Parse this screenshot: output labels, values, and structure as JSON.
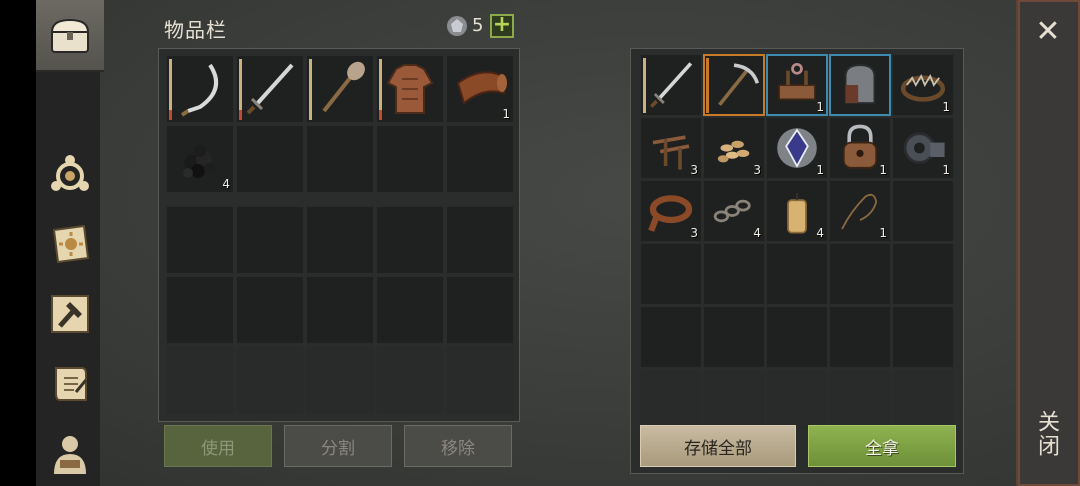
{
  "inventory": {
    "title": "物品栏",
    "gem_count": "5",
    "plus_label": "+",
    "slots_row1": [
      {
        "icon": "sickle-icon",
        "qty": ""
      },
      {
        "icon": "sword-icon",
        "qty": ""
      },
      {
        "icon": "shovel-icon",
        "qty": ""
      },
      {
        "icon": "leather-armor-icon",
        "qty": ""
      },
      {
        "icon": "leather-roll-icon",
        "qty": "1"
      }
    ],
    "slots_row2": [
      {
        "icon": "coal-icon",
        "qty": "4"
      }
    ],
    "buttons": {
      "use": "使用",
      "split": "分割",
      "remove": "移除"
    }
  },
  "container": {
    "items": [
      {
        "icon": "sword-icon",
        "qty": ""
      },
      {
        "icon": "pickaxe-icon",
        "qty": ""
      },
      {
        "icon": "anchor-rack-icon",
        "qty": "1"
      },
      {
        "icon": "armor-gauntlet-icon",
        "qty": ""
      },
      {
        "icon": "bear-trap-icon",
        "qty": "1"
      },
      {
        "icon": "nails-icon",
        "qty": "3"
      },
      {
        "icon": "seeds-icon",
        "qty": "3"
      },
      {
        "icon": "crystal-icon",
        "qty": "1"
      },
      {
        "icon": "padlock-icon",
        "qty": "1"
      },
      {
        "icon": "gear-icon",
        "qty": "1"
      },
      {
        "icon": "leather-strap-icon",
        "qty": "3"
      },
      {
        "icon": "chain-icon",
        "qty": "4"
      },
      {
        "icon": "candle-icon",
        "qty": "4"
      },
      {
        "icon": "rope-icon",
        "qty": "1"
      }
    ],
    "buttons": {
      "store_all": "存储全部",
      "take_all": "全拿"
    }
  },
  "close": {
    "x": "✕",
    "label": "关闭"
  },
  "colors": {
    "accent_green": "#8fb250",
    "orange_highlight": "#c67b28",
    "blue_highlight": "#3e8bb2"
  }
}
